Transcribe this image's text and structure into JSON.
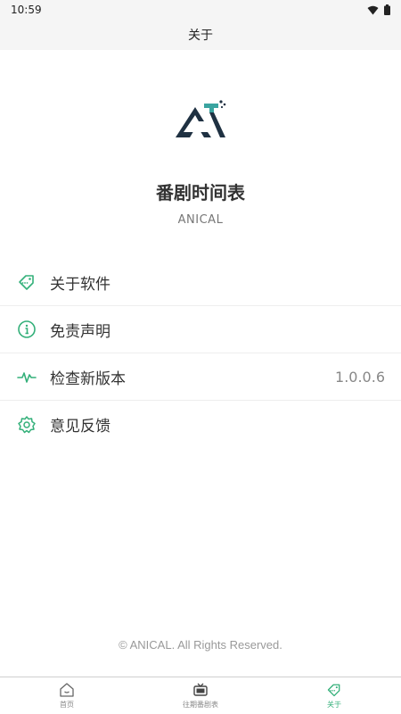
{
  "status_bar": {
    "time": "10:59"
  },
  "app_bar": {
    "title": "关于"
  },
  "app": {
    "name": "番剧时间表",
    "subtitle": "ANICAL"
  },
  "menu": [
    {
      "label": "关于软件",
      "icon": "tag-icon"
    },
    {
      "label": "免责声明",
      "icon": "info-icon"
    },
    {
      "label": "检查新版本",
      "icon": "pulse-icon",
      "value": "1.0.0.6"
    },
    {
      "label": "意见反馈",
      "icon": "gear-icon"
    }
  ],
  "footer": {
    "copyright": "© ANICAL. All Rights Reserved."
  },
  "tabs": [
    {
      "label": "首页",
      "icon": "home-icon",
      "active": false
    },
    {
      "label": "往期番剧表",
      "icon": "tv-icon",
      "active": false
    },
    {
      "label": "关于",
      "icon": "tag-icon",
      "active": true
    }
  ],
  "colors": {
    "accent": "#34b07a",
    "logo_dark": "#1f3142",
    "logo_teal": "#3aa4a0"
  }
}
